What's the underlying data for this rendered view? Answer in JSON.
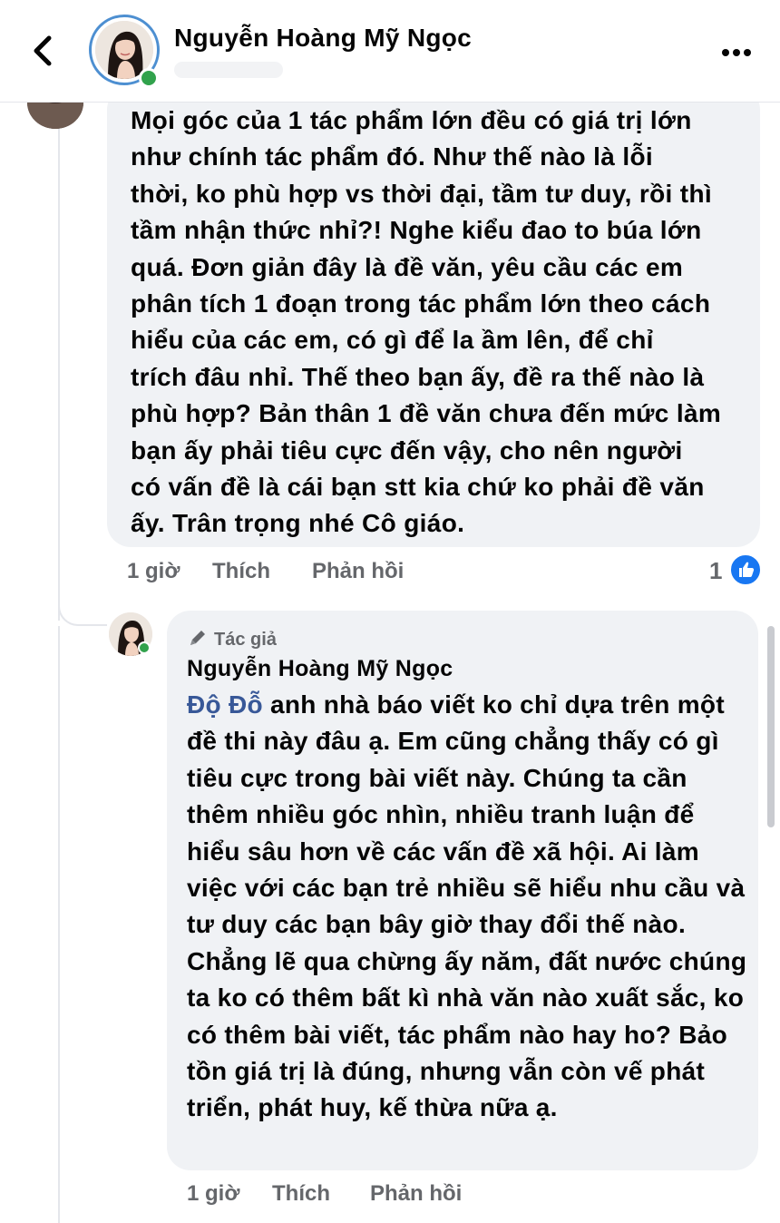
{
  "header": {
    "author_name": "Nguyễn Hoàng Mỹ Ngọc",
    "back_icon": "chevron-left-icon",
    "more_icon": "more-horizontal-icon"
  },
  "comment_1": {
    "text": "Mọi góc của 1 tác phẩm lớn đều có giá trị lớn\nnhư chính tác phẩm đó. Như thế nào là lỗi\nthời, ko phù hợp vs thời đại, tầm tư duy, rồi thì\ntầm nhận thức nhỉ?! Nghe kiểu đao to búa lớn\nquá. Đơn giản đây là đề văn, yêu cầu các em\nphân tích 1 đoạn trong tác phẩm lớn theo cách\nhiểu của các em, có gì để la ầm lên, để chỉ\ntrích đâu nhỉ. Thế theo bạn ấy, đề ra thế nào là\nphù hợp? Bản thân 1 đề văn chưa đến mức làm\nbạn ấy phải tiêu cực đến vậy, cho nên người\ncó vấn đề là cái bạn stt kia chứ ko phải đề văn\nấy. Trân trọng nhé Cô giáo.",
    "time": "1 giờ",
    "like_label": "Thích",
    "reply_label": "Phản hồi",
    "like_count": "1",
    "reaction_icon": "thumbs-up-icon"
  },
  "comment_2": {
    "badge_label": "Tác giả",
    "badge_icon": "pen-icon",
    "author_name": "Nguyễn Hoàng Mỹ Ngọc",
    "mention": "Độ Đỗ",
    "text": " anh nhà báo viết ko chỉ dựa trên một đề thi này đâu ạ. Em cũng chẳng thấy có gì tiêu cực trong bài viết này. Chúng ta cần thêm nhiều góc nhìn, nhiều tranh luận để hiểu sâu hơn về các vấn đề xã hội. Ai làm việc với các bạn trẻ nhiều sẽ hiểu nhu cầu và tư duy các bạn bây giờ thay đổi thế nào. Chẳng lẽ qua chừng ấy năm, đất nước chúng ta ko có thêm bất kì nhà văn nào xuất sắc, ko có thêm bài viết, tác phẩm nào hay ho? Bảo tồn giá trị là đúng, nhưng vẫn còn vế phát triển, phát huy, kế thừa nữa ạ.",
    "time": "1 giờ",
    "like_label": "Thích",
    "reply_label": "Phản hồi"
  },
  "colors": {
    "bubble": "#f0f2f5",
    "mention": "#385898",
    "meta": "#65676b",
    "online": "#31a24c",
    "like_blue": "#1877f2"
  }
}
